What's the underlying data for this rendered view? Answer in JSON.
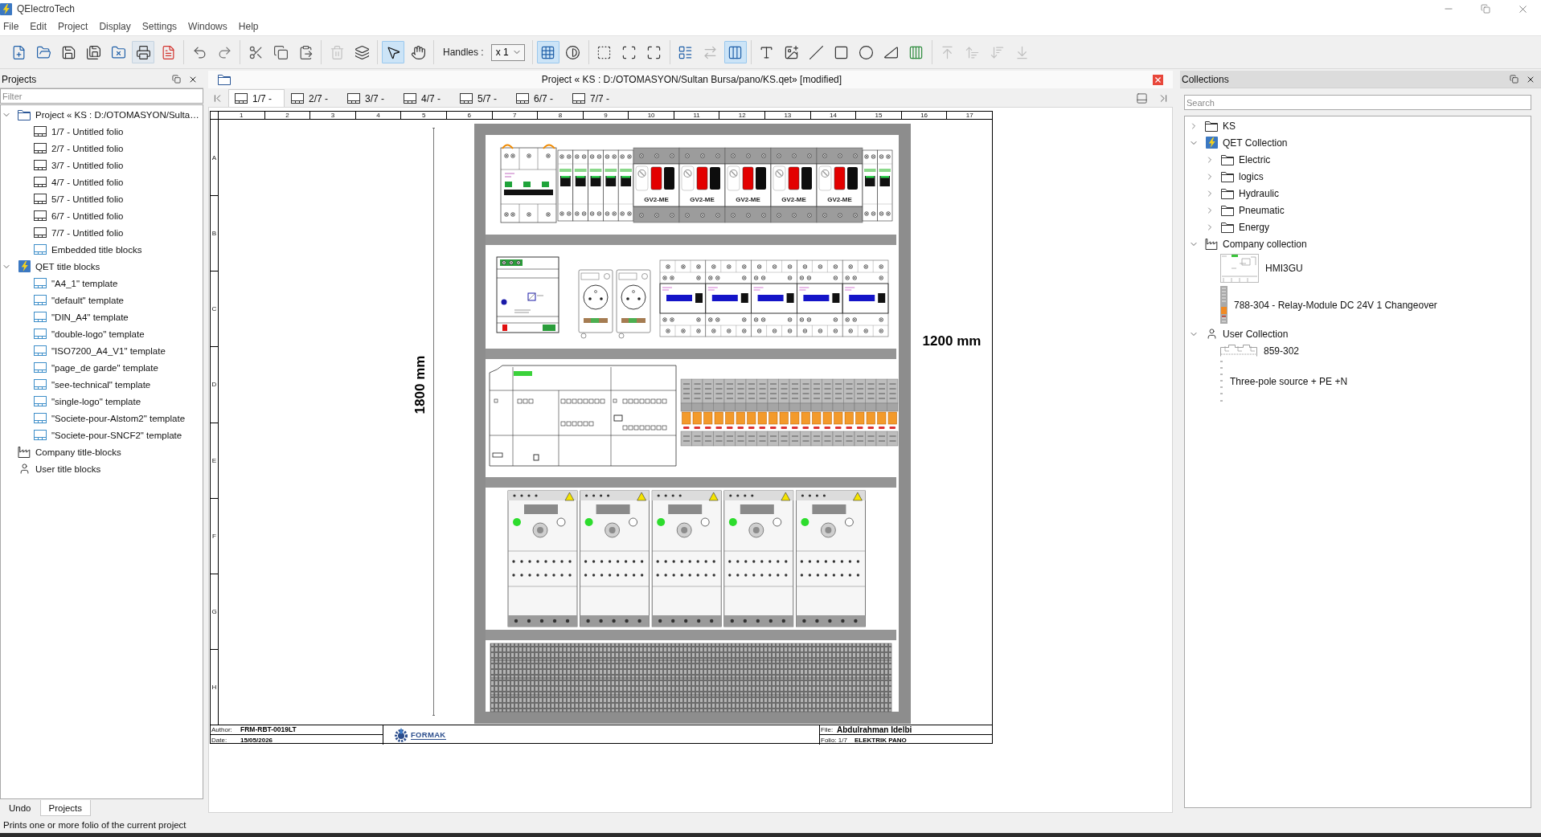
{
  "window": {
    "title": "QElectroTech"
  },
  "menu": [
    "File",
    "Edit",
    "Project",
    "Display",
    "Settings",
    "Windows",
    "Help"
  ],
  "toolbar": [
    {
      "kind": "buttons",
      "buttons": [
        {
          "pressed": false,
          "hovered": false,
          "disabled": false
        },
        {
          "pressed": false,
          "hovered": false,
          "disabled": false
        },
        {
          "pressed": false,
          "hovered": false,
          "disabled": false
        },
        {
          "pressed": false,
          "hovered": false,
          "disabled": false
        },
        {
          "pressed": false,
          "hovered": false,
          "disabled": false
        },
        {
          "pressed": false,
          "hovered": true,
          "disabled": false
        },
        {
          "pressed": false,
          "hovered": false,
          "disabled": false
        }
      ]
    },
    {
      "kind": "buttons",
      "buttons": [
        {
          "pressed": false,
          "hovered": false,
          "disabled": false
        },
        {
          "pressed": false,
          "hovered": false,
          "disabled": false
        }
      ]
    },
    {
      "kind": "buttons",
      "buttons": [
        {
          "pressed": false,
          "hovered": false,
          "disabled": false
        },
        {
          "pressed": false,
          "hovered": false,
          "disabled": false
        },
        {
          "pressed": false,
          "hovered": false,
          "disabled": false
        }
      ]
    },
    {
      "kind": "buttons",
      "buttons": [
        {
          "pressed": false,
          "hovered": false,
          "disabled": true
        },
        {
          "pressed": false,
          "hovered": false,
          "disabled": false
        }
      ]
    },
    {
      "kind": "buttons",
      "buttons": [
        {
          "pressed": true,
          "hovered": false,
          "disabled": false
        },
        {
          "pressed": false,
          "hovered": false,
          "disabled": false
        }
      ]
    },
    {
      "kind": "handles",
      "label": "Handles :",
      "value": "x 1"
    },
    {
      "kind": "buttons",
      "buttons": [
        {
          "pressed": true,
          "hovered": false,
          "disabled": false
        },
        {
          "pressed": false,
          "hovered": false,
          "disabled": false
        }
      ]
    },
    {
      "kind": "buttons",
      "buttons": [
        {
          "pressed": false,
          "hovered": false,
          "disabled": false
        },
        {
          "pressed": false,
          "hovered": false,
          "disabled": false
        },
        {
          "pressed": false,
          "hovered": false,
          "disabled": false
        }
      ]
    },
    {
      "kind": "buttons",
      "buttons": [
        {
          "pressed": false,
          "hovered": false,
          "disabled": false
        },
        {
          "pressed": false,
          "hovered": false,
          "disabled": true
        },
        {
          "pressed": true,
          "hovered": false,
          "disabled": false
        }
      ]
    },
    {
      "kind": "buttons",
      "buttons": [
        {
          "pressed": false,
          "hovered": false,
          "disabled": false
        },
        {
          "pressed": false,
          "hovered": false,
          "disabled": false
        },
        {
          "pressed": false,
          "hovered": false,
          "disabled": false
        },
        {
          "pressed": false,
          "hovered": false,
          "disabled": false
        },
        {
          "pressed": false,
          "hovered": false,
          "disabled": false
        },
        {
          "pressed": false,
          "hovered": false,
          "disabled": false
        },
        {
          "pressed": false,
          "hovered": false,
          "disabled": false
        }
      ]
    },
    {
      "kind": "buttons",
      "buttons": [
        {
          "pressed": false,
          "hovered": false,
          "disabled": true
        },
        {
          "pressed": false,
          "hovered": false,
          "disabled": true
        },
        {
          "pressed": false,
          "hovered": false,
          "disabled": true
        },
        {
          "pressed": false,
          "hovered": false,
          "disabled": true
        }
      ]
    }
  ],
  "projects_panel": {
    "title": "Projects",
    "filter": {
      "placeholder": "Filter"
    },
    "tree": [
      {
        "kind": "project",
        "label": "Project « KS : D:/OTOMASYON/Sulta…",
        "expanded": true,
        "children": [
          {
            "kind": "folio",
            "label": "1/7 - Untitled folio"
          },
          {
            "kind": "folio",
            "label": "2/7 - Untitled folio"
          },
          {
            "kind": "folio",
            "label": "3/7 - Untitled folio"
          },
          {
            "kind": "folio",
            "label": "4/7 - Untitled folio"
          },
          {
            "kind": "folio",
            "label": "5/7 - Untitled folio"
          },
          {
            "kind": "folio",
            "label": "6/7 - Untitled folio"
          },
          {
            "kind": "folio",
            "label": "7/7 - Untitled folio"
          },
          {
            "kind": "template",
            "label": "Embedded title blocks"
          }
        ]
      },
      {
        "kind": "qet",
        "label": "QET title blocks",
        "expanded": true,
        "children": [
          {
            "kind": "template",
            "label": "\"A4_1\" template"
          },
          {
            "kind": "template",
            "label": "\"default\" template"
          },
          {
            "kind": "template",
            "label": "\"DIN_A4\" template"
          },
          {
            "kind": "template",
            "label": "\"double-logo\" template"
          },
          {
            "kind": "template",
            "label": "\"ISO7200_A4_V1\" template"
          },
          {
            "kind": "template",
            "label": "\"page_de garde\" template"
          },
          {
            "kind": "template",
            "label": "\"see-technical\" template"
          },
          {
            "kind": "template",
            "label": "\"single-logo\" template"
          },
          {
            "kind": "template",
            "label": "\"Societe-pour-Alstom2\" template"
          },
          {
            "kind": "template",
            "label": "\"Societe-pour-SNCF2\" template"
          }
        ]
      },
      {
        "kind": "company",
        "label": "Company title-blocks"
      },
      {
        "kind": "user",
        "label": "User title blocks"
      }
    ]
  },
  "editor": {
    "title": "Project « KS : D:/OTOMASYON/Sultan Bursa/pano/KS.qet» [modified]",
    "tabs": [
      {
        "label": "1/7 -",
        "selected": true
      },
      {
        "label": "2/7 -",
        "selected": false
      },
      {
        "label": "3/7 -",
        "selected": false
      },
      {
        "label": "4/7 -",
        "selected": false
      },
      {
        "label": "5/7 -",
        "selected": false
      },
      {
        "label": "6/7 -",
        "selected": false
      },
      {
        "label": "7/7 -",
        "selected": false
      }
    ],
    "sheet": {
      "columns": [
        "1",
        "2",
        "3",
        "4",
        "5",
        "6",
        "7",
        "8",
        "9",
        "10",
        "11",
        "12",
        "13",
        "14",
        "15",
        "16",
        "17"
      ],
      "rows": [
        "A",
        "B",
        "C",
        "D",
        "E",
        "F",
        "G",
        "H"
      ],
      "drawing": {
        "height_label": "1800 mm",
        "width_label": "1200 mm",
        "motor_breakers": [
          "GV2-ME",
          "GV2-ME",
          "GV2-ME",
          "GV2-ME",
          "GV2-ME"
        ]
      },
      "title_block": {
        "author_label": "Author:",
        "author": "FRM-RBT-0019LT",
        "date_label": "Date:",
        "date": "15/05/2026",
        "logo": "FORMAK",
        "file_label": "File:",
        "file": "Abdulrahman Idelbi",
        "folio_label": "Folio: 1/7",
        "folio_title": "ELEKTRIK PANO"
      }
    }
  },
  "collections_panel": {
    "title": "Collections",
    "search": {
      "placeholder": "Search"
    },
    "tree": [
      {
        "kind": "folder",
        "label": "KS",
        "expanded": false
      },
      {
        "kind": "qet",
        "label": "QET Collection",
        "expanded": true,
        "children": [
          {
            "kind": "folder",
            "label": "Electric",
            "expanded": false
          },
          {
            "kind": "folder",
            "label": "logics",
            "expanded": false
          },
          {
            "kind": "folder",
            "label": "Hydraulic",
            "expanded": false
          },
          {
            "kind": "folder",
            "label": "Pneumatic",
            "expanded": false
          },
          {
            "kind": "folder",
            "label": "Energy",
            "expanded": false
          }
        ]
      },
      {
        "kind": "company",
        "label": "Company collection",
        "expanded": true,
        "children": [
          {
            "kind": "hmi",
            "label": "HMI3GU"
          },
          {
            "kind": "relay",
            "label": "788-304 - Relay-Module DC 24V 1 Changeover"
          }
        ]
      },
      {
        "kind": "user",
        "label": "User Collection",
        "expanded": true,
        "children": [
          {
            "kind": "terminal",
            "label": "859-302"
          },
          {
            "kind": "source",
            "label": "Three-pole source + PE +N"
          }
        ]
      }
    ]
  },
  "dock_tabs": [
    {
      "label": "Undo",
      "selected": false
    },
    {
      "label": "Projects",
      "selected": true
    }
  ],
  "status_bar": {
    "text": "Prints one or more folio of the current project"
  }
}
